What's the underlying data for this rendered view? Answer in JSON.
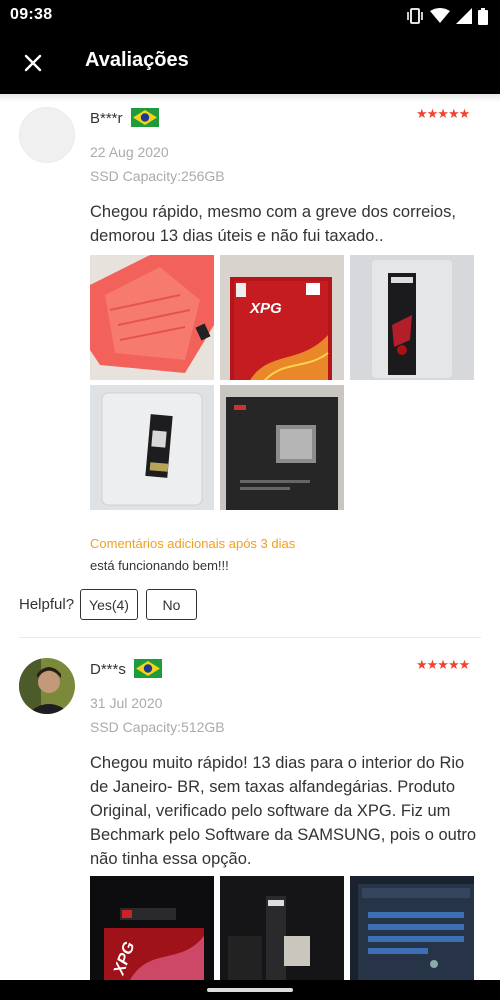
{
  "status_bar": {
    "time": "09:38",
    "icons": [
      "vibrate-icon",
      "wifi-icon",
      "signal-icon",
      "battery-icon"
    ]
  },
  "header": {
    "close_icon": "close-icon",
    "title": "Avaliações"
  },
  "reviews": [
    {
      "name": "B***r",
      "country_flag": "flag-brazil",
      "stars": "★★★★★",
      "rating": 5,
      "date": "22 Aug 2020",
      "variant": "SSD Capacity:256GB",
      "text_lines": [
        "Chegou rápido, mesmo com a greve dos correios,",
        "demorou 13 dias úteis e não fui taxado.."
      ],
      "photo_count": 5,
      "followup_label": "Comentários adicionais após 3 dias",
      "followup_text": "está funcionando bem!!!",
      "helpful_label": "Helpful?",
      "yes_label": "Yes(4)",
      "no_label": "No"
    },
    {
      "name": "D***s",
      "country_flag": "flag-brazil",
      "stars": "★★★★★",
      "rating": 5,
      "date": "31 Jul 2020",
      "variant": "SSD Capacity:512GB",
      "text_lines": [
        "Chegou muito rápido! 13 dias para o interior do Rio",
        "de Janeiro- BR, sem taxas alfandegárias. Produto",
        "Original, verificado pelo software da XPG. Fiz um",
        "Bechmark pelo Software da SAMSUNG, pois o outro",
        "não tinha essa opção."
      ],
      "photo_count": 3
    }
  ],
  "colors": {
    "bar_background": "#000000",
    "star": "#f0442f",
    "followup_label": "#f0a020",
    "meta_text": "#aaaaaa",
    "body_text": "#333333"
  }
}
